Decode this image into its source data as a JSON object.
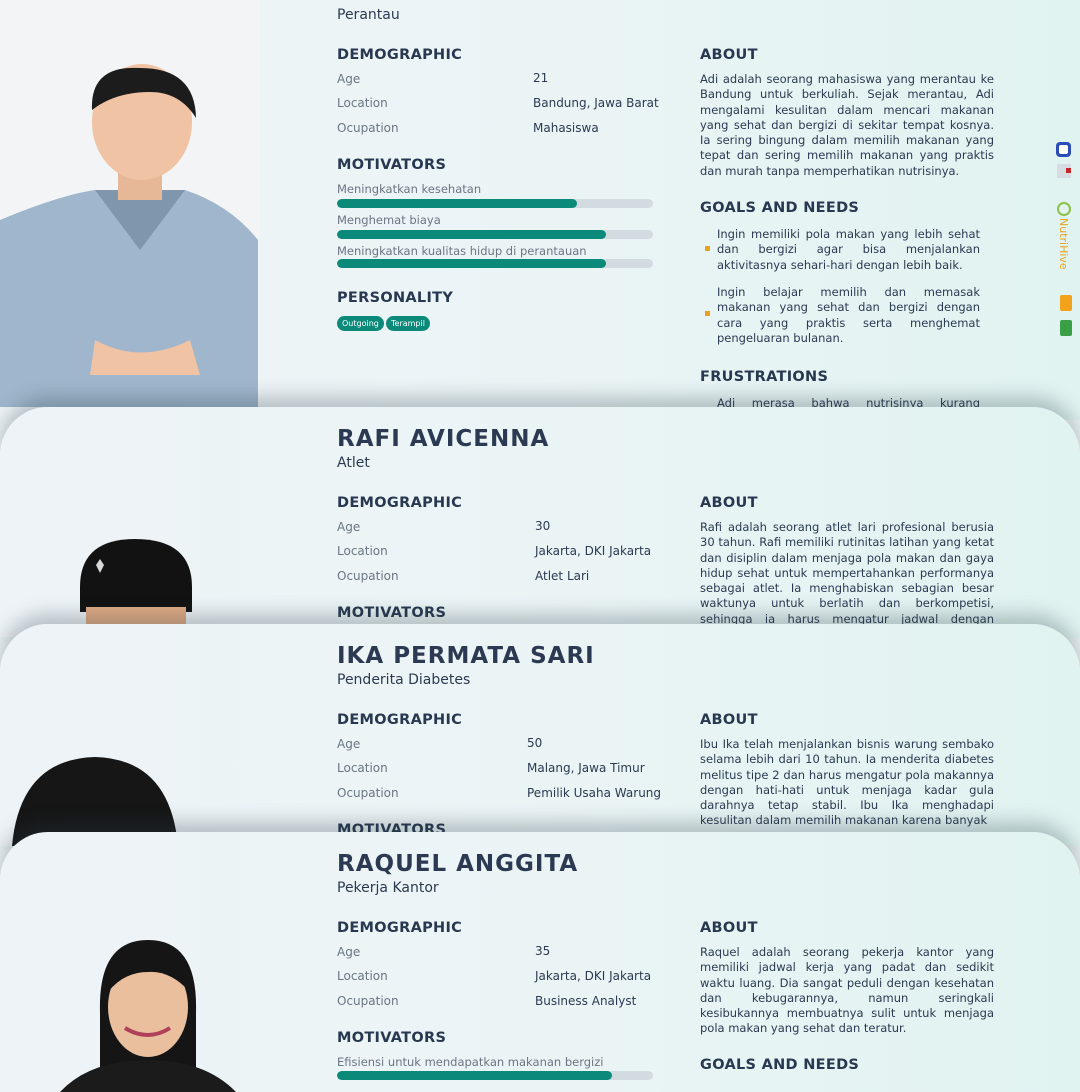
{
  "personas": [
    {
      "name": "",
      "role": "Perantau",
      "demographic_title": "DEMOGRAPHIC",
      "age_label": "Age",
      "age": "21",
      "location_label": "Location",
      "location": "Bandung, Jawa Barat",
      "occupation_label": "Ocupation",
      "occupation": "Mahasiswa",
      "motivators_title": "MOTIVATORS",
      "motivators": [
        {
          "label": "Meningkatkan kesehatan",
          "level": 0.76
        },
        {
          "label": "Menghemat biaya",
          "level": 0.85
        },
        {
          "label": "Meningkatkan kualitas hidup di perantauan",
          "level": 0.85
        }
      ],
      "personality_title": "PERSONALITY",
      "personality": [
        "Outgoing",
        "Terampil"
      ],
      "about_title": "ABOUT",
      "about": "Adi adalah seorang mahasiswa yang merantau ke Bandung untuk berkuliah. Sejak merantau, Adi mengalami kesulitan dalam mencari makanan yang sehat dan bergizi di sekitar tempat kosnya. Ia sering bingung dalam memilih makanan yang tepat dan sering memilih makanan yang praktis dan murah tanpa memperhatikan nutrisinya.",
      "goals_title": "GOALS AND NEEDS",
      "goals": [
        "Ingin memiliki pola makan yang lebih sehat dan bergizi agar bisa menjalankan aktivitasnya sehari-hari dengan lebih baik.",
        "Ingin belajar memilih dan memasak makanan yang sehat dan bergizi dengan cara yang praktis serta menghemat pengeluaran bulanan."
      ],
      "frustrations_title": "FRUSTRATIONS",
      "frustrations": "Adi merasa bahwa nutrisinya kurang tercukupi"
    },
    {
      "name": "RAFI AVICENNA",
      "role": "Atlet",
      "demographic_title": "DEMOGRAPHIC",
      "age_label": "Age",
      "age": "30",
      "location_label": "Location",
      "location": "Jakarta, DKI Jakarta",
      "occupation_label": "Ocupation",
      "occupation": "Atlet Lari",
      "motivators_title": "MOTIVATORS",
      "about_title": "ABOUT",
      "about": "Rafi adalah seorang atlet lari profesional berusia 30 tahun. Rafi memiliki rutinitas latihan yang ketat dan disiplin dalam menjaga pola makan dan gaya hidup sehat untuk mempertahankan performanya sebagai atlet. Ia menghabiskan sebagian besar waktunya untuk berlatih dan berkompetisi, sehingga ia harus mengatur jadwal dengan cermat untuk"
    },
    {
      "name": "IKA PERMATA SARI",
      "role": "Penderita Diabetes",
      "demographic_title": "DEMOGRAPHIC",
      "age_label": "Age",
      "age": "50",
      "location_label": "Location",
      "location": "Malang, Jawa Timur",
      "occupation_label": "Ocupation",
      "occupation": "Pemilik Usaha Warung",
      "motivators_title": "MOTIVATORS",
      "about_title": "ABOUT",
      "about": "Ibu Ika telah menjalankan bisnis warung sembako selama lebih dari 10 tahun. Ia menderita diabetes melitus tipe 2 dan harus mengatur pola makannya dengan hati-hati untuk menjaga kadar gula darahnya tetap stabil. Ibu Ika menghadapi kesulitan dalam memilih makanan karena banyak"
    },
    {
      "name": "RAQUEL ANGGITA",
      "role": "Pekerja Kantor",
      "demographic_title": "DEMOGRAPHIC",
      "age_label": "Age",
      "age": "35",
      "location_label": "Location",
      "location": "Jakarta, DKI Jakarta",
      "occupation_label": "Ocupation",
      "occupation": "Business Analyst",
      "motivators_title": "MOTIVATORS",
      "motivators": [
        {
          "label": "Efisiensi untuk mendapatkan makanan bergizi",
          "level": 0.87
        }
      ],
      "about_title": "ABOUT",
      "about": "Raquel adalah seorang pekerja kantor yang memiliki jadwal kerja yang padat dan sedikit waktu luang. Dia sangat peduli dengan kesehatan dan kebugarannya, namun seringkali kesibukannya membuatnya sulit untuk menjaga pola makan yang sehat dan teratur.",
      "goals_title": "GOALS AND NEEDS"
    }
  ],
  "sidebar": {
    "brand": "NutriHive"
  },
  "colors": {
    "accent": "#0b8a7a",
    "bullet": "#e9a21f",
    "track": "#d2dbe0",
    "text": "#2b3a52"
  }
}
